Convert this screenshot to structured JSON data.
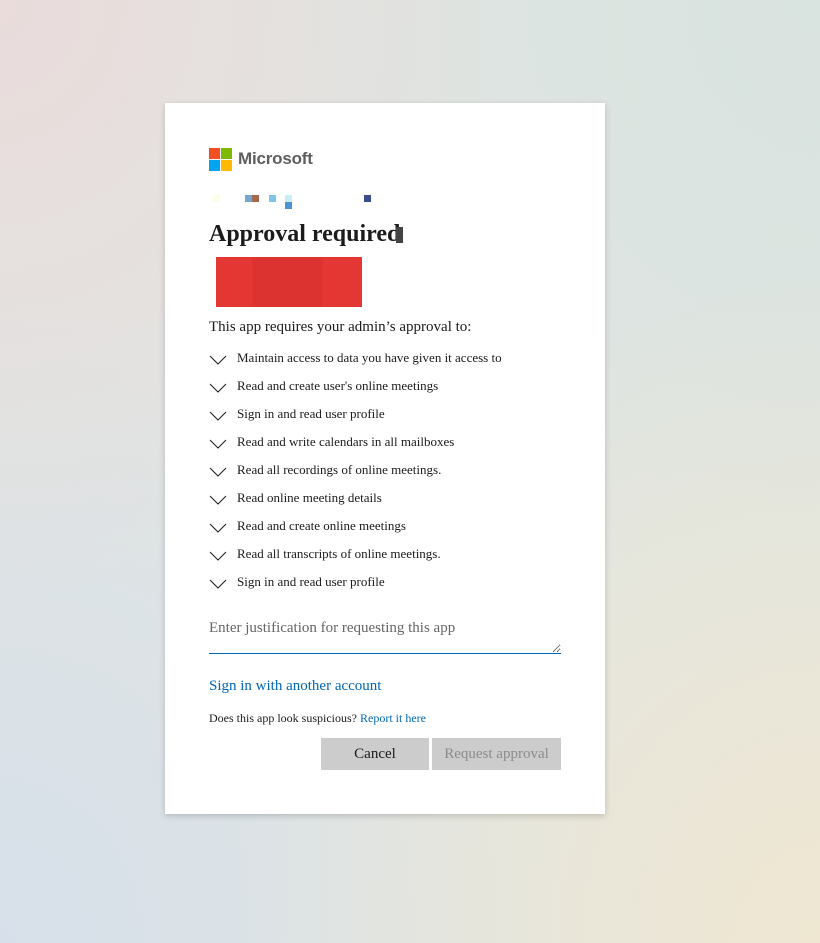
{
  "brand": {
    "name": "Microsoft",
    "colors": {
      "red": "#f25022",
      "green": "#7fba00",
      "blue": "#00a4ef",
      "yellow": "#ffb900"
    }
  },
  "heading": {
    "title": "Approval required"
  },
  "intro": "This app requires your admin’s approval to:",
  "permissions": [
    "Maintain access to data you have given it access to",
    "Read and create user's online meetings",
    "Sign in and read user profile",
    "Read and write calendars in all mailboxes",
    "Read all recordings of online meetings.",
    "Read online meeting details",
    "Read and create online meetings",
    "Read all transcripts of online meetings.",
    "Sign in and read user profile"
  ],
  "justification": {
    "placeholder": "Enter justification for requesting this app",
    "value": ""
  },
  "links": {
    "sign_in_another": "Sign in with another account",
    "suspicious_prompt": "Does this app look suspicious?",
    "report": "Report it here"
  },
  "buttons": {
    "cancel": "Cancel",
    "request": "Request approval"
  },
  "icons": {
    "permission": "chevron-down-icon"
  },
  "colors": {
    "link": "#0067b8",
    "button_bg": "#cccccc",
    "redaction": "#e43632"
  }
}
